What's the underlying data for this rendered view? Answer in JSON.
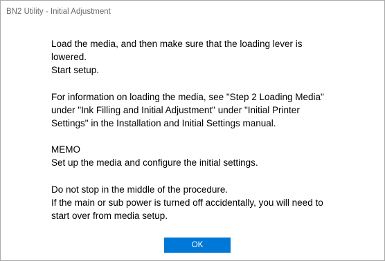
{
  "window": {
    "title": "BN2 Utility - Initial Adjustment"
  },
  "message": {
    "p1": "Load the media, and then make sure that the loading lever is\nlowered.\nStart setup.",
    "p2": "For information on loading the media, see \"Step 2 Loading Media\"\nunder \"Ink Filling and Initial Adjustment\" under \"Initial Printer\nSettings\" in the Installation and Initial Settings manual.",
    "p3": "MEMO\nSet up the media and configure the initial settings.",
    "p4": "Do not stop in the middle of the procedure.\nIf the main or sub power is turned off accidentally, you will need to\nstart over from media setup."
  },
  "buttons": {
    "ok_label": "OK"
  },
  "colors": {
    "accent": "#0078d7",
    "border": "#a8a8a8",
    "title_text": "#6b6b6b"
  }
}
